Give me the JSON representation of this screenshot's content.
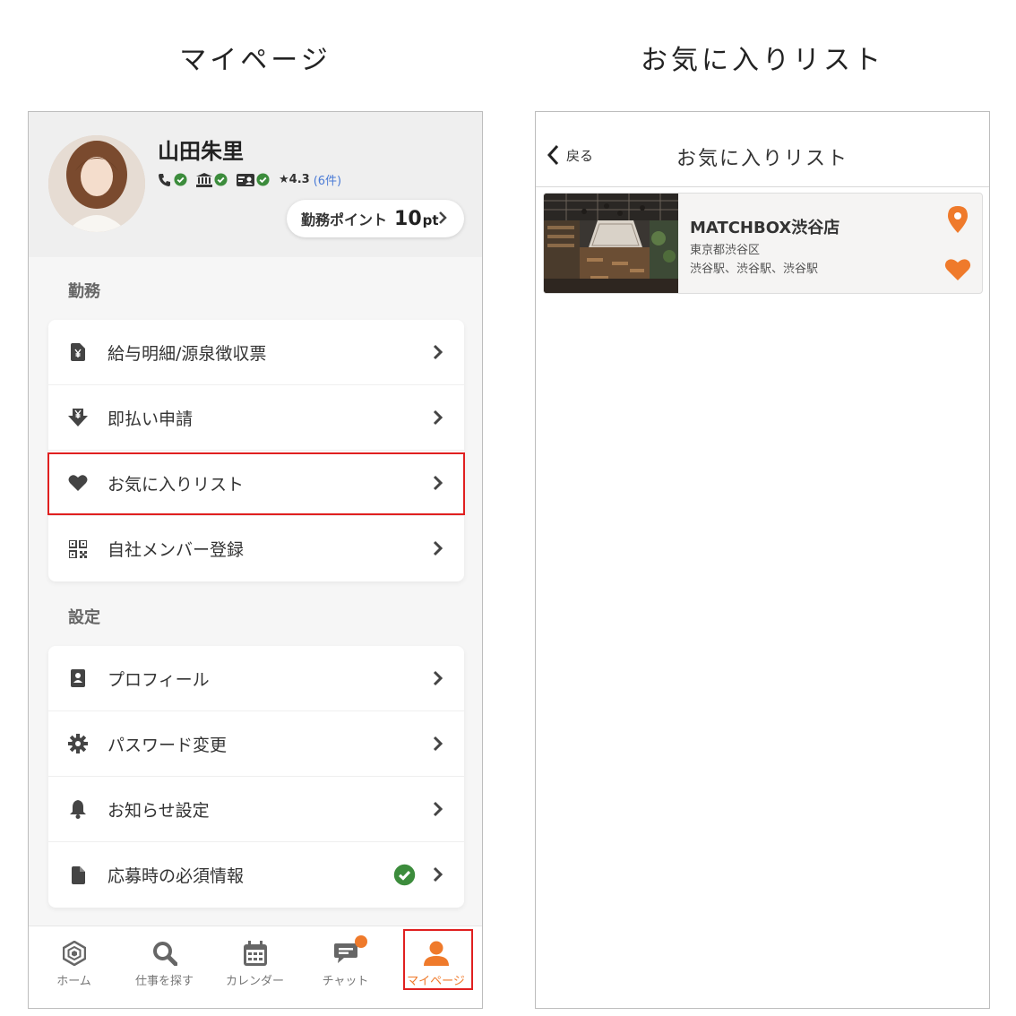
{
  "captions": {
    "left": "マイページ",
    "right": "お気に入りリスト"
  },
  "profile": {
    "name": "山田朱里",
    "rating": "★4.3",
    "rating_count": "(6件)",
    "points_label": "勤務ポイント",
    "points_value": "10",
    "points_unit": "pt"
  },
  "sections": {
    "work_title": "勤務",
    "work_items": [
      {
        "label": "給与明細/源泉徴収票",
        "icon": "yen-file-icon"
      },
      {
        "label": "即払い申請",
        "icon": "yen-download-icon"
      },
      {
        "label": "お気に入りリスト",
        "icon": "heart-icon"
      },
      {
        "label": "自社メンバー登録",
        "icon": "qr-code-icon"
      }
    ],
    "settings_title": "設定",
    "settings_items": [
      {
        "label": "プロフィール",
        "icon": "id-card-icon"
      },
      {
        "label": "パスワード変更",
        "icon": "gear-icon"
      },
      {
        "label": "お知らせ設定",
        "icon": "bell-icon"
      },
      {
        "label": "応募時の必須情報",
        "icon": "file-icon"
      }
    ]
  },
  "tabbar": {
    "tabs": [
      {
        "label": "ホーム",
        "icon": "home-hexagon-icon"
      },
      {
        "label": "仕事を探す",
        "icon": "search-icon"
      },
      {
        "label": "カレンダー",
        "icon": "calendar-icon"
      },
      {
        "label": "チャット",
        "icon": "chat-icon"
      },
      {
        "label": "マイページ",
        "icon": "user-icon"
      }
    ],
    "active": "マイページ"
  },
  "favorites": {
    "back_label": "戻る",
    "title": "お気に入りリスト",
    "items": [
      {
        "name": "MATCHBOX渋谷店",
        "address": "東京都渋谷区",
        "stations": "渋谷駅、渋谷駅、渋谷駅"
      }
    ]
  },
  "colors": {
    "accent": "#ef7a2b",
    "highlight": "#e02020",
    "verified": "#3c8c3c",
    "link": "#4a7bd6"
  }
}
